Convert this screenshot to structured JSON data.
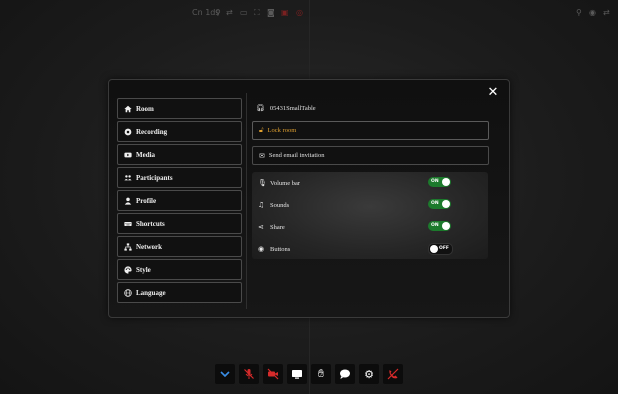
{
  "topbar": {
    "left_text": "Cn 1ds",
    "left_icons": [
      "mic-icon",
      "swap-icon",
      "screen-icon",
      "fullscreen-icon",
      "camera-icon",
      "record-icon",
      "stop-icon"
    ],
    "right_icons": [
      "mic-icon",
      "eye-icon",
      "swap-icon"
    ]
  },
  "settings": {
    "close_label": "✕",
    "menu": [
      {
        "label": "Room",
        "icon": "home-icon"
      },
      {
        "label": "Recording",
        "icon": "record-icon"
      },
      {
        "label": "Media",
        "icon": "youtube-icon"
      },
      {
        "label": "Participants",
        "icon": "users-icon"
      },
      {
        "label": "Profile",
        "icon": "user-icon"
      },
      {
        "label": "Shortcuts",
        "icon": "keyboard-icon"
      },
      {
        "label": "Network",
        "icon": "network-icon"
      },
      {
        "label": "Style",
        "icon": "palette-icon"
      },
      {
        "label": "Language",
        "icon": "globe-icon"
      }
    ],
    "room_name": "05431SmallTable",
    "lock_room_label": "Lock room",
    "send_email_label": "Send email invitation",
    "toggles": [
      {
        "label": "Volume bar",
        "state": "ON",
        "icon": "mic-icon"
      },
      {
        "label": "Sounds",
        "state": "ON",
        "icon": "music-icon"
      },
      {
        "label": "Share",
        "state": "ON",
        "icon": "share-icon"
      },
      {
        "label": "Buttons",
        "state": "OFF",
        "icon": "eye-icon"
      }
    ]
  },
  "bottombar": {
    "buttons": [
      {
        "name": "collapse-button",
        "icon": "chevron-down-icon",
        "color": "#3a8ee6"
      },
      {
        "name": "mic-toggle-button",
        "icon": "mic-off-icon",
        "color": "#d62b2b"
      },
      {
        "name": "video-toggle-button",
        "icon": "video-off-icon",
        "color": "#d62b2b"
      },
      {
        "name": "screen-share-button",
        "icon": "screen-icon",
        "color": "#ffffff"
      },
      {
        "name": "raise-hand-button",
        "icon": "hand-icon",
        "color": "#ffffff"
      },
      {
        "name": "chat-button",
        "icon": "chat-icon",
        "color": "#ffffff"
      },
      {
        "name": "settings-button",
        "icon": "gears-icon",
        "color": "#ffffff"
      },
      {
        "name": "leave-button",
        "icon": "phone-off-icon",
        "color": "#d62b2b"
      }
    ]
  }
}
